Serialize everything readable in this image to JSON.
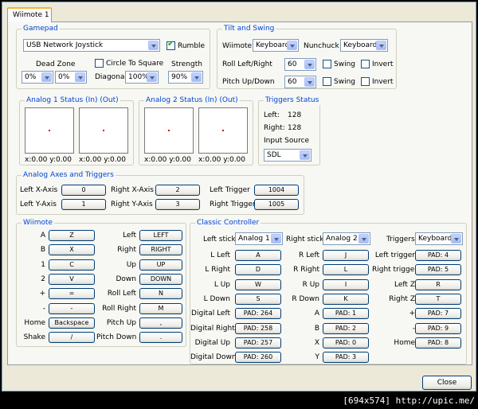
{
  "tab_label": "Wiimote 1",
  "gamepad": {
    "title": "Gamepad",
    "device": "USB Network Joystick",
    "rumble_label": "Rumble",
    "rumble_checked": true,
    "deadzone_label": "Dead Zone",
    "deadzone_a": "0%",
    "deadzone_b": "0%",
    "circle_label": "Circle To Square",
    "diagonal_label": "Diagonal",
    "diagonal_value": "100%",
    "strength_label": "Strength",
    "strength_value": "90%"
  },
  "tilt": {
    "title": "Tilt and Swing",
    "wiimote_label": "Wiimote",
    "wiimote_value": "Keyboard",
    "nunchuck_label": "Nunchuck",
    "nunchuck_value": "Keyboard",
    "roll_label": "Roll Left/Right",
    "roll_value": "60",
    "pitch_label": "Pitch Up/Down",
    "pitch_value": "60",
    "swing_label": "Swing",
    "invert_label": "Invert"
  },
  "analog1": {
    "title": "Analog 1 Status (In) (Out)",
    "in_xy": "x:0.00 y:0.00",
    "out_xy": "x:0.00 y:0.00"
  },
  "analog2": {
    "title": "Analog 2 Status (In) (Out)",
    "in_xy": "x:0.00 y:0.00",
    "out_xy": "x:0.00 y:0.00"
  },
  "triggers": {
    "title": "Triggers Status",
    "left_label": "Left:",
    "left_value": "128",
    "right_label": "Right:",
    "right_value": "128",
    "input_label": "Input Source",
    "input_value": "SDL"
  },
  "axes": {
    "title": "Analog Axes and Triggers",
    "lx_label": "Left X-Axis",
    "lx": "0",
    "ly_label": "Left Y-Axis",
    "ly": "1",
    "rx_label": "Right X-Axis",
    "rx": "2",
    "ry_label": "Right Y-Axis",
    "ry": "3",
    "lt_label": "Left Trigger",
    "lt": "1004",
    "rt_label": "Right Trigger",
    "rt": "1005"
  },
  "wiimote": {
    "title": "Wiimote",
    "left": [
      {
        "l": "A",
        "v": "Z"
      },
      {
        "l": "B",
        "v": "X"
      },
      {
        "l": "1",
        "v": "C"
      },
      {
        "l": "2",
        "v": "V"
      },
      {
        "l": "+",
        "v": "="
      },
      {
        "l": "-",
        "v": "-"
      },
      {
        "l": "Home",
        "v": "Backspace"
      },
      {
        "l": "Shake",
        "v": "/"
      }
    ],
    "right": [
      {
        "l": "Left",
        "v": "LEFT"
      },
      {
        "l": "Right",
        "v": "RIGHT"
      },
      {
        "l": "Up",
        "v": "UP"
      },
      {
        "l": "Down",
        "v": "DOWN"
      },
      {
        "l": "Roll Left",
        "v": "N"
      },
      {
        "l": "Roll Right",
        "v": "M"
      },
      {
        "l": "Pitch Up",
        "v": ","
      },
      {
        "l": "Pitch Down",
        "v": "."
      }
    ]
  },
  "classic": {
    "title": "Classic Controller",
    "lstick_label": "Left stick",
    "lstick_value": "Analog 1",
    "rstick_label": "Right stick",
    "rstick_value": "Analog 2",
    "trig_label": "Triggers",
    "trig_value": "Keyboard",
    "col1": [
      {
        "l": "L Left",
        "v": "A"
      },
      {
        "l": "L Right",
        "v": "D"
      },
      {
        "l": "L Up",
        "v": "W"
      },
      {
        "l": "L Down",
        "v": "S"
      },
      {
        "l": "Digital Left",
        "v": "PAD: 264"
      },
      {
        "l": "Digital Right",
        "v": "PAD: 258"
      },
      {
        "l": "Digital Up",
        "v": "PAD: 257"
      },
      {
        "l": "Digital Down",
        "v": "PAD: 260"
      }
    ],
    "col2": [
      {
        "l": "R Left",
        "v": "J"
      },
      {
        "l": "R Right",
        "v": "L"
      },
      {
        "l": "R Up",
        "v": "I"
      },
      {
        "l": "R Down",
        "v": "K"
      },
      {
        "l": "A",
        "v": "PAD: 1"
      },
      {
        "l": "B",
        "v": "PAD: 2"
      },
      {
        "l": "X",
        "v": "PAD: 0"
      },
      {
        "l": "Y",
        "v": "PAD: 3"
      }
    ],
    "col3": [
      {
        "l": "Left trigger",
        "v": "PAD: 4"
      },
      {
        "l": "Right trigger",
        "v": "PAD: 5"
      },
      {
        "l": "Left Z",
        "v": "R"
      },
      {
        "l": "Right Z",
        "v": "T"
      },
      {
        "l": "+",
        "v": "PAD: 7"
      },
      {
        "l": "-",
        "v": "PAD: 9"
      },
      {
        "l": "Home",
        "v": "PAD: 8"
      }
    ]
  },
  "close_label": "Close",
  "watermark": "[694x574] http://upic.me/"
}
